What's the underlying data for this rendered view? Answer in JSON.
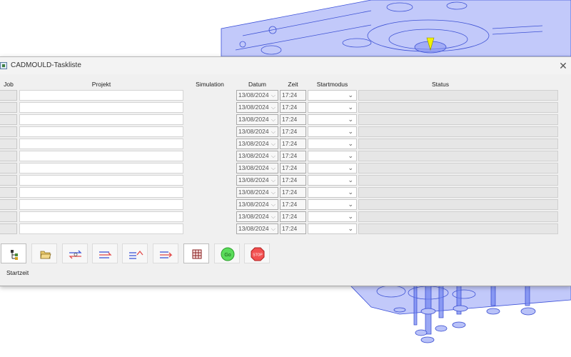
{
  "window": {
    "title": "CADMOULD-Taskliste",
    "close_glyph": "✕"
  },
  "headers": {
    "job": "Job",
    "projekt": "Projekt",
    "simulation": "Simulation",
    "datum": "Datum",
    "zeit": "Zeit",
    "startmodus": "Startmodus",
    "status": "Status"
  },
  "rows": [
    {
      "datum": "13/08/2024",
      "zeit": "17:24"
    },
    {
      "datum": "13/08/2024",
      "zeit": "17:24"
    },
    {
      "datum": "13/08/2024",
      "zeit": "17:24"
    },
    {
      "datum": "13/08/2024",
      "zeit": "17:24"
    },
    {
      "datum": "13/08/2024",
      "zeit": "17:24"
    },
    {
      "datum": "13/08/2024",
      "zeit": "17:24"
    },
    {
      "datum": "13/08/2024",
      "zeit": "17:24"
    },
    {
      "datum": "13/08/2024",
      "zeit": "17:24"
    },
    {
      "datum": "13/08/2024",
      "zeit": "17:24"
    },
    {
      "datum": "13/08/2024",
      "zeit": "17:24"
    },
    {
      "datum": "13/08/2024",
      "zeit": "17:24"
    },
    {
      "datum": "13/08/2024",
      "zeit": "17:24"
    }
  ],
  "toolbar": {
    "buttons": [
      {
        "icon": "tree-structure-icon"
      },
      {
        "icon": "open-folder-icon"
      },
      {
        "icon": "swap-arrows-icon"
      },
      {
        "icon": "move-up-arrows-icon"
      },
      {
        "icon": "move-back-arrows-icon"
      },
      {
        "icon": "arrow-right-list-icon"
      },
      {
        "icon": "grid-table-icon"
      },
      {
        "icon": "go-icon",
        "label": "Go"
      },
      {
        "icon": "stop-icon",
        "label": "STOP"
      }
    ]
  },
  "footer": {
    "startzeit_label": "Startzeit"
  },
  "colors": {
    "model_blue": "#4a63e6",
    "window_bg": "#f0f0f0",
    "go_green": "#5bdc5b",
    "stop_red": "#f25050"
  }
}
